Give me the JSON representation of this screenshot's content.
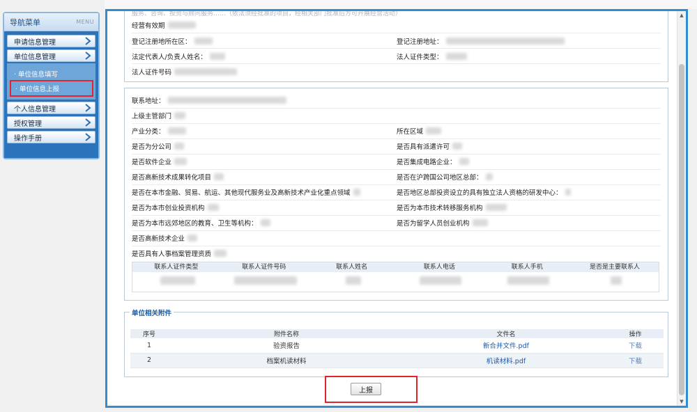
{
  "sidebar": {
    "title": "导航菜单",
    "menu_tag": "MENU",
    "items": [
      {
        "label": "申请信息管理"
      },
      {
        "label": "单位信息管理"
      },
      {
        "label": "个人信息管理"
      },
      {
        "label": "授权管理"
      },
      {
        "label": "操作手册"
      }
    ],
    "submenu": [
      {
        "label": "· 单位信息填写"
      },
      {
        "label": "· 单位信息上报"
      }
    ]
  },
  "section1": {
    "top_partial": "服务、咨询、投资与顾问服务……（依法须经批准的项目，经相关部门批准后方可开展经营活动）",
    "fields": {
      "validity": "经营有效期",
      "reg_district": "登记注册地所在区：",
      "reg_address": "登记注册地址：",
      "legal_rep": "法定代表人/负责人姓名：",
      "legal_id_type": "法人证件类型：",
      "legal_id_no": "法人证件号码"
    }
  },
  "section2": {
    "fields": {
      "contact_address": "联系地址：",
      "superior": "上级主管部门",
      "industry": "产业分类：",
      "region": "所在区域",
      "branch": "是否为分公司",
      "dispatch": "是否具有派遣许可",
      "software": "是否软件企业",
      "ic": "是否集成电路企业：",
      "hitech_transform": "是否高新技术成果转化项目",
      "hq": "是否在沪跨国公司地区总部：",
      "key_field": "是否在本市金融、贸易、航运、其他现代服务业及高新技术产业化重点领域",
      "rd_center": "是否地区总部投资设立的具有独立法人资格的研发中心：",
      "venture_inv": "是否为本市创业投资机构",
      "tech_transfer": "是否为本市技术转移服务机构",
      "suburb": "是否为本市远郊地区的教育、卫生等机构：",
      "returnee": "是否为留学人员创业机构",
      "hitech": "是否高新技术企业",
      "archive": "是否具有人事档案管理资质"
    },
    "contacts_headers": [
      "联系人证件类型",
      "联系人证件号码",
      "联系人姓名",
      "联系人电话",
      "联系人手机",
      "是否是主要联系人"
    ]
  },
  "attachments": {
    "legend": "单位相关附件",
    "headers": [
      "序号",
      "附件名称",
      "文件名",
      "操作"
    ],
    "rows": [
      {
        "no": "1",
        "name": "验资报告",
        "file": "新合并文件.pdf",
        "action": "下载"
      },
      {
        "no": "2",
        "name": "档案机读材料",
        "file": "机读材料.pdf",
        "action": "下载"
      }
    ]
  },
  "submit_label": "上报",
  "colors": {
    "accent": "#2f8dd1",
    "highlight": "#e0242c",
    "sidebar": "#2b73bb"
  }
}
